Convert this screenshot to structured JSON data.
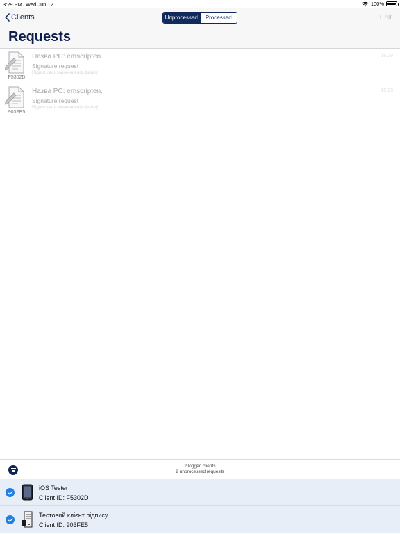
{
  "status_bar": {
    "time": "3:29 PM",
    "date": "Wed Jun 12",
    "battery": "100%"
  },
  "nav": {
    "back_label": "Clients",
    "segments": [
      {
        "label": "Unprocessed",
        "active": true
      },
      {
        "label": "Processed",
        "active": false
      }
    ],
    "edit_label": "Edit",
    "title": "Requests"
  },
  "requests": [
    {
      "id": "F5302D",
      "title": "Назва PC: emscripten.",
      "subtitle": "Signature request",
      "desc": "Підпис геш-значення від файлу",
      "time": "15:29",
      "icon": "document-signature-icon"
    },
    {
      "id": "903FE5",
      "title": "Назва PC: emscripten.",
      "subtitle": "Signature request",
      "desc": "Підпис геш-значення від файлу",
      "time": "15:29",
      "icon": "document-signature-icon"
    }
  ],
  "summary": {
    "logged": "2 logged clients",
    "unprocessed": "2 unprocessed requests"
  },
  "clients": [
    {
      "name": "iOS Tester",
      "client_id": "Client ID: F5302D",
      "icon": "phone-icon",
      "selected": true
    },
    {
      "name": "Тестовий клієнт підпису",
      "client_id": "Client ID: 903FE5",
      "icon": "computer-icon",
      "selected": true
    }
  ],
  "colors": {
    "accent": "#102a5c",
    "check": "#1f7fe5",
    "client_bg": "#e8eef7"
  }
}
